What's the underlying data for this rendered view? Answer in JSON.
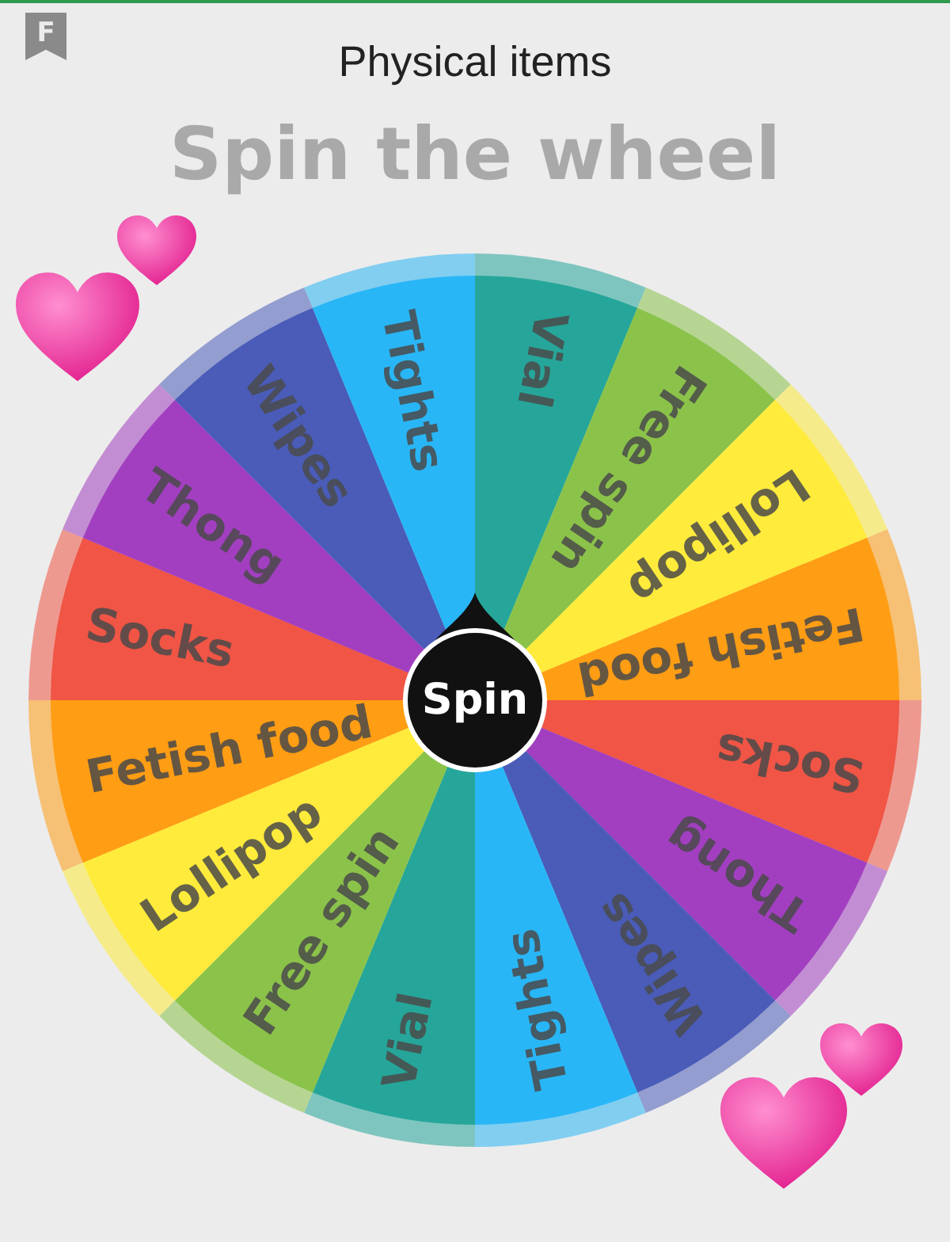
{
  "top_bar": {
    "bookmark_letter": "F",
    "title": "Physical items"
  },
  "heading": "Spin the wheel",
  "wheel": {
    "segments": [
      {
        "label": "Vial",
        "color": "#26a69a"
      },
      {
        "label": "Free spin",
        "color": "#8bc34a"
      },
      {
        "label": "Lollipop",
        "color": "#ffeb3b"
      },
      {
        "label": "Fetish food",
        "color": "#ff9d14"
      },
      {
        "label": "Socks",
        "color": "#f05545"
      },
      {
        "label": "Thong",
        "color": "#a23fc0"
      },
      {
        "label": "Wipes",
        "color": "#4a5cb8"
      },
      {
        "label": "Tights",
        "color": "#29b6f6"
      },
      {
        "label": "Vial",
        "color": "#26a69a"
      },
      {
        "label": "Free spin",
        "color": "#8bc34a"
      },
      {
        "label": "Lollipop",
        "color": "#ffeb3b"
      },
      {
        "label": "Fetish food",
        "color": "#ff9d14"
      },
      {
        "label": "Socks",
        "color": "#f05545"
      },
      {
        "label": "Thong",
        "color": "#a23fc0"
      },
      {
        "label": "Wipes",
        "color": "#4a5cb8"
      },
      {
        "label": "Tights",
        "color": "#29b6f6"
      }
    ],
    "spin_label": "Spin"
  }
}
